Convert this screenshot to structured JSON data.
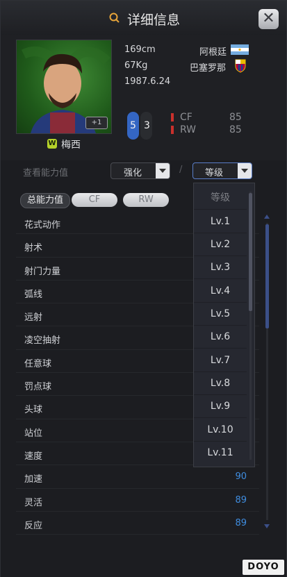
{
  "window": {
    "title": "详细信息",
    "close_label": "✕"
  },
  "player": {
    "name": "梅西",
    "badge_letter": "W",
    "plus_label": "+1",
    "height": "169cm",
    "weight": "67Kg",
    "birthday": "1987.6.24",
    "nation": "阿根廷",
    "club": "巴塞罗那",
    "foot_left": "5",
    "foot_right": "3",
    "positions": [
      {
        "name": "CF",
        "value": "85"
      },
      {
        "name": "RW",
        "value": "85"
      }
    ]
  },
  "filter": {
    "label": "查看能力值",
    "enhance_label": "强化",
    "level_label": "等级",
    "separator": "/"
  },
  "tabs": [
    {
      "label": "总能力值",
      "active": true
    },
    {
      "label": "CF",
      "active": false
    },
    {
      "label": "RW",
      "active": false
    }
  ],
  "stats": [
    {
      "name": "花式动作",
      "value": ""
    },
    {
      "name": "射术",
      "value": ""
    },
    {
      "name": "射门力量",
      "value": ""
    },
    {
      "name": "弧线",
      "value": ""
    },
    {
      "name": "远射",
      "value": ""
    },
    {
      "name": "凌空抽射",
      "value": ""
    },
    {
      "name": "任意球",
      "value": ""
    },
    {
      "name": "罚点球",
      "value": ""
    },
    {
      "name": "头球",
      "value": ""
    },
    {
      "name": "站位",
      "value": ""
    },
    {
      "name": "速度",
      "value": ""
    },
    {
      "name": "加速",
      "value": "90"
    },
    {
      "name": "灵活",
      "value": "89"
    },
    {
      "name": "反应",
      "value": "89"
    }
  ],
  "level_menu": {
    "header": "等级",
    "options": [
      "Lv.1",
      "Lv.2",
      "Lv.3",
      "Lv.4",
      "Lv.5",
      "Lv.6",
      "Lv.7",
      "Lv.8",
      "Lv.9",
      "Lv.10",
      "Lv.11"
    ]
  },
  "watermark": "DOYO",
  "colors": {
    "accent_blue": "#3f8de0",
    "position_red": "#c9302c",
    "title_icon_orange": "#e8a53a"
  }
}
